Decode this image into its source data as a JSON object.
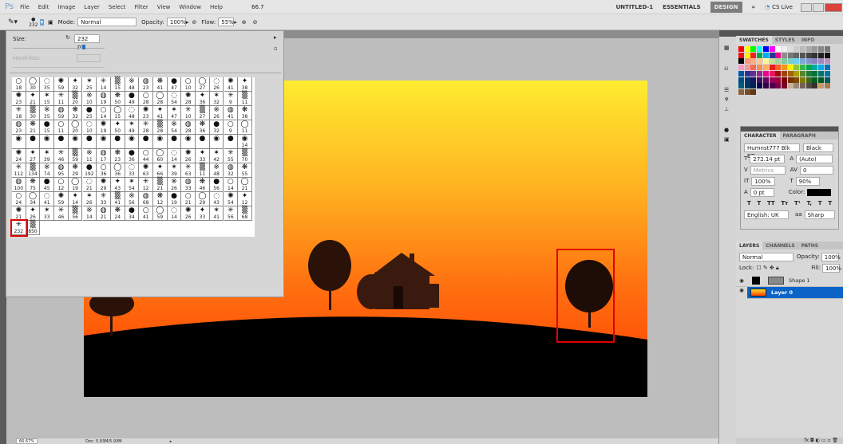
{
  "menu": {
    "logo": "Ps",
    "items": [
      "File",
      "Edit",
      "Image",
      "Layer",
      "Select",
      "Filter",
      "View",
      "Window",
      "Help"
    ],
    "zoom": "66.7",
    "workspaces": [
      "UNTITLED-1",
      "ESSENTIALS",
      "DESIGN"
    ],
    "more": "»",
    "cslive": "CS Live"
  },
  "options": {
    "brush_size": "232",
    "mode_label": "Mode:",
    "mode": "Normal",
    "opacity_label": "Opacity:",
    "opacity": "100%",
    "flow_label": "Flow:",
    "flow": "55%"
  },
  "brush_picker": {
    "size_label": "Size:",
    "size": "232 px",
    "size_fraction": 0.5,
    "hardness_label": "Hardness:",
    "rows": [
      [
        "18",
        "30",
        "35",
        "59",
        "32",
        "25",
        "14",
        "15",
        "48",
        "23",
        "41",
        "47",
        "10",
        "27",
        "26",
        "41",
        "38"
      ],
      [
        "23",
        "21",
        "15",
        "11",
        "20",
        "10",
        "19",
        "50",
        "49",
        "28",
        "28",
        "54",
        "28",
        "36",
        "32",
        "9",
        "11"
      ],
      [
        "18",
        "30",
        "35",
        "59",
        "32",
        "25",
        "14",
        "15",
        "48",
        "23",
        "41",
        "47",
        "10",
        "27",
        "26",
        "41",
        "38"
      ],
      [
        "23",
        "21",
        "15",
        "11",
        "20",
        "10",
        "19",
        "50",
        "49",
        "28",
        "28",
        "54",
        "28",
        "36",
        "32",
        "9",
        "11"
      ],
      [
        "",
        "",
        "",
        "",
        "",
        "",
        "",
        "",
        "",
        "",
        "",
        "",
        "",
        "",
        "",
        "",
        "14"
      ],
      [
        "24",
        "27",
        "39",
        "46",
        "59",
        "11",
        "17",
        "23",
        "36",
        "44",
        "60",
        "14",
        "26",
        "33",
        "42",
        "55",
        "70"
      ],
      [
        "112",
        "134",
        "74",
        "95",
        "29",
        "192",
        "36",
        "36",
        "33",
        "63",
        "66",
        "39",
        "63",
        "11",
        "48",
        "32",
        "55"
      ],
      [
        "100",
        "75",
        "45",
        "12",
        "19",
        "21",
        "29",
        "43",
        "54",
        "12",
        "21",
        "26",
        "33",
        "46",
        "56",
        "14",
        "21"
      ],
      [
        "24",
        "34",
        "41",
        "59",
        "14",
        "26",
        "33",
        "41",
        "56",
        "68",
        "12",
        "19",
        "21",
        "29",
        "43",
        "54",
        "12"
      ],
      [
        "21",
        "26",
        "33",
        "46",
        "56",
        "14",
        "21",
        "24",
        "34",
        "41",
        "59",
        "14",
        "26",
        "33",
        "41",
        "56",
        "68"
      ],
      [
        "232",
        "850"
      ]
    ],
    "selected": "232"
  },
  "swatches": {
    "tabs": [
      "SWATCHES",
      "STYLES",
      "INFO"
    ],
    "colors": [
      "#ff0000",
      "#ffff00",
      "#00ff00",
      "#00ffff",
      "#0000ff",
      "#ff00ff",
      "#ffffff",
      "#eeeeee",
      "#dddddd",
      "#cccccc",
      "#bbbbbb",
      "#aaaaaa",
      "#999999",
      "#888888",
      "#777777",
      "#ee1111",
      "#ffee00",
      "#ee2222",
      "#00a651",
      "#00aeef",
      "#2e3192",
      "#ec008c",
      "#8c8c8c",
      "#777",
      "#666",
      "#555",
      "#444",
      "#333",
      "#222",
      "#111",
      "#000",
      "#f7977a",
      "#f9ad81",
      "#fdc68a",
      "#fff79a",
      "#c4df9b",
      "#a3d39c",
      "#82ca9d",
      "#7bcdc8",
      "#6ecff6",
      "#7ea7d8",
      "#8493ca",
      "#8882be",
      "#a187be",
      "#bc8dbf",
      "#f49ac2",
      "#f6989d",
      "#f26c4f",
      "#f68e55",
      "#fbaf5c",
      "#ed1c24",
      "#f26522",
      "#f7941d",
      "#fff200",
      "#8dc73f",
      "#39b54a",
      "#00a651",
      "#00a99d",
      "#00aeef",
      "#0072bc",
      "#0054a6",
      "#2e3192",
      "#662d91",
      "#92278f",
      "#ec008c",
      "#ed145b",
      "#9e0b0f",
      "#a0410d",
      "#a36209",
      "#aba000",
      "#598527",
      "#197b30",
      "#007236",
      "#00746b",
      "#0076a3",
      "#004b80",
      "#003471",
      "#1b1464",
      "#440e62",
      "#630460",
      "#9e005d",
      "#9e0039",
      "#790000",
      "#7b2e00",
      "#7d4900",
      "#827b00",
      "#406618",
      "#005e20",
      "#005826",
      "#005952",
      "#005b7f",
      "#003663",
      "#002157",
      "#0d004c",
      "#32004b",
      "#4b0049",
      "#7b0046",
      "#7a0026",
      "#c7b299",
      "#998675",
      "#736357",
      "#534741",
      "#37302d",
      "#c69c6d",
      "#a67c52",
      "#8c6239",
      "#754c24",
      "#603913"
    ]
  },
  "character": {
    "tabs": [
      "CHARACTER",
      "PARAGRAPH"
    ],
    "font": "Humnst777 Blk BT",
    "style": "Black",
    "size": "272.14 pt",
    "leading": "(Auto)",
    "kerning": "Metrics",
    "tracking": "0",
    "vscale": "100%",
    "hscale": "90%",
    "baseline": "0 pt",
    "color_label": "Color:",
    "styles": [
      "T",
      "T",
      "TT",
      "Tт",
      "T¹",
      "T,",
      "T",
      "T"
    ],
    "language": "English: UK",
    "aa_icon": "aa",
    "antialias": "Sharp"
  },
  "layers": {
    "tabs": [
      "LAYERS",
      "CHANNELS",
      "PATHS"
    ],
    "blend": "Normal",
    "opacity_label": "Opacity:",
    "opacity": "100%",
    "lock_label": "Lock:",
    "fill_label": "Fill:",
    "fill": "100%",
    "items": [
      {
        "name": "Shape 1",
        "selected": false
      },
      {
        "name": "Layer 0",
        "selected": true
      }
    ]
  },
  "status": {
    "zoom": "66.67%",
    "doc": "Doc: 5.93M/5.93M"
  },
  "colors": {
    "accent": "#0a64c8",
    "selection_red": "#e00000"
  }
}
